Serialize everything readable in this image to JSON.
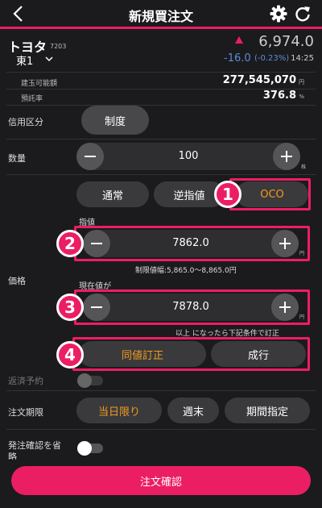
{
  "header": {
    "title": "新規買注文"
  },
  "stock": {
    "name": "トヨタ",
    "code": "7203",
    "market": "東1",
    "price": "6,974.0",
    "change": "-16.0",
    "change_pct": "(-0.23%)",
    "time": "14:25"
  },
  "info": {
    "buying_power_label": "建玉可能額",
    "buying_power_value": "277,545,070",
    "buying_power_unit": "円",
    "margin_rate_label": "預託率",
    "margin_rate_value": "376.8",
    "margin_rate_unit": "%"
  },
  "credit": {
    "label": "信用区分",
    "value": "制度"
  },
  "quantity": {
    "label": "数量",
    "value": "100",
    "unit": "株"
  },
  "price": {
    "label": "価格",
    "tabs": [
      "通常",
      "逆指値",
      "OCO"
    ],
    "limit_label": "指値",
    "limit_value": "7862.0",
    "limit_unit": "円",
    "range_note": "制限値幅:5,865.0〜8,865.0円",
    "trigger_label": "現在値が",
    "trigger_value": "7878.0",
    "trigger_unit": "円",
    "trigger_note": "以上 になったら下記条件で訂正",
    "mode_options": [
      "同値訂正",
      "成行"
    ]
  },
  "repay": {
    "label": "返済予約"
  },
  "period": {
    "label": "注文期限",
    "options": [
      "当日限り",
      "週末",
      "期間指定"
    ]
  },
  "skip_confirm": {
    "label_line1": "発注確認を省",
    "label_line2": "略"
  },
  "submit_label": "注文確認",
  "badges": [
    "1",
    "2",
    "3",
    "4"
  ],
  "colors": {
    "accent": "#ec1e63",
    "orange": "#f39b1e",
    "blue": "#5b8dd6"
  }
}
